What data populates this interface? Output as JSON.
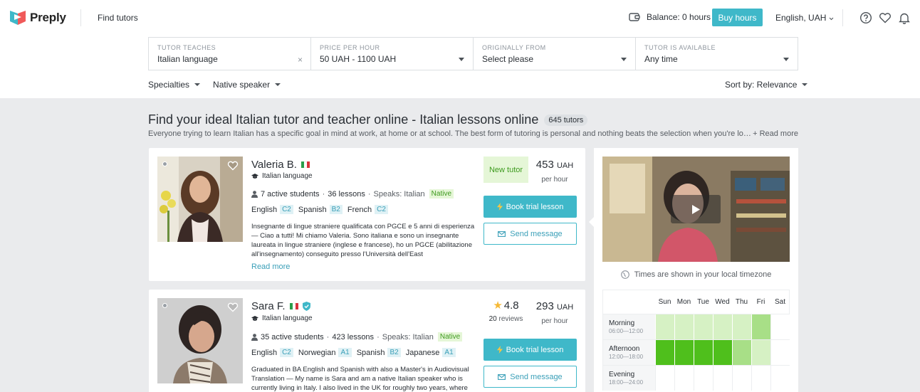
{
  "header": {
    "brand": "Preply",
    "find_tutors": "Find tutors",
    "balance": "Balance: 0 hours",
    "buy_hours": "Buy hours",
    "language_currency": "English, UAH"
  },
  "filters": [
    {
      "label": "TUTOR TEACHES",
      "value": "Italian language",
      "control": "clear"
    },
    {
      "label": "PRICE PER HOUR",
      "value": "50 UAH - 1100 UAH",
      "control": "dropdown"
    },
    {
      "label": "ORIGINALLY FROM",
      "value": "Select please",
      "control": "dropdown"
    },
    {
      "label": "TUTOR IS AVAILABLE",
      "value": "Any time",
      "control": "dropdown"
    }
  ],
  "subfilters": {
    "specialties": "Specialties",
    "native_speaker": "Native speaker",
    "sort_by": "Sort by: Relevance"
  },
  "page": {
    "title": "Find your ideal Italian tutor and teacher online - Italian lessons online",
    "count": "645 tutors",
    "intro": "Everyone trying to learn Italian has a specific goal in mind at work, at home or at school. The best form of tutoring is personal and nothing beats the selection when you're looking to…",
    "read_more": "+ Read more"
  },
  "tutors": [
    {
      "name": "Valeria B.",
      "subject": "Italian language",
      "active_students": "7 active students",
      "lessons": "36 lessons",
      "speaks": "Speaks: Italian",
      "native": "Native",
      "languages": [
        {
          "name": "English",
          "level": "C2"
        },
        {
          "name": "Spanish",
          "level": "B2"
        },
        {
          "name": "French",
          "level": "C2"
        }
      ],
      "description": "Insegnante di lingue straniere qualificata con PGCE e 5 anni di esperienza — Ciao a tutti! Mi chiamo Valeria. Sono italiana e sono un insegnante laureata in lingue straniere (inglese e francese), ho un PGCE (abilitazione all'insegnamento) conseguito presso l'Università dell'East",
      "read_more": "Read more",
      "badge": "New tutor",
      "price": "453",
      "currency": "UAH",
      "per_hour": "per hour",
      "book": "Book trial lesson",
      "message": "Send message"
    },
    {
      "name": "Sara F.",
      "subject": "Italian language",
      "active_students": "35 active students",
      "lessons": "423 lessons",
      "speaks": "Speaks: Italian",
      "native": "Native",
      "languages": [
        {
          "name": "English",
          "level": "C2"
        },
        {
          "name": "Norwegian",
          "level": "A1"
        },
        {
          "name": "Spanish",
          "level": "B2"
        },
        {
          "name": "Japanese",
          "level": "A1"
        }
      ],
      "description": "Graduated in BA English and Spanish with also a Master's in Audiovisual Translation — My name is Sara and am a native Italian speaker who is currently living in Italy. I also lived in the UK for roughly two years, where",
      "rating": "4.8",
      "reviews_count": "20",
      "reviews_label": "reviews",
      "price": "293",
      "currency": "UAH",
      "per_hour": "per hour",
      "book": "Book trial lesson",
      "message": "Send message"
    }
  ],
  "side_panel": {
    "timezone_note": "Times are shown in your local timezone",
    "days": [
      "Sun",
      "Mon",
      "Tue",
      "Wed",
      "Thu",
      "Fri",
      "Sat"
    ],
    "slots": [
      {
        "name": "Morning",
        "hours": "06:00—12:00",
        "levels": [
          1,
          1,
          1,
          1,
          1,
          2,
          0
        ]
      },
      {
        "name": "Afternoon",
        "hours": "12:00—18:00",
        "levels": [
          3,
          3,
          3,
          3,
          2,
          1,
          0
        ]
      },
      {
        "name": "Evening",
        "hours": "18:00—24:00",
        "levels": [
          0,
          0,
          0,
          0,
          0,
          0,
          0
        ]
      }
    ]
  },
  "colors": {
    "accent": "#3fb8c9",
    "native_green": "#3d9a1e",
    "availability_high": "#4fbf1c",
    "availability_mid": "#a8df87",
    "availability_low": "#d6f1c4"
  }
}
